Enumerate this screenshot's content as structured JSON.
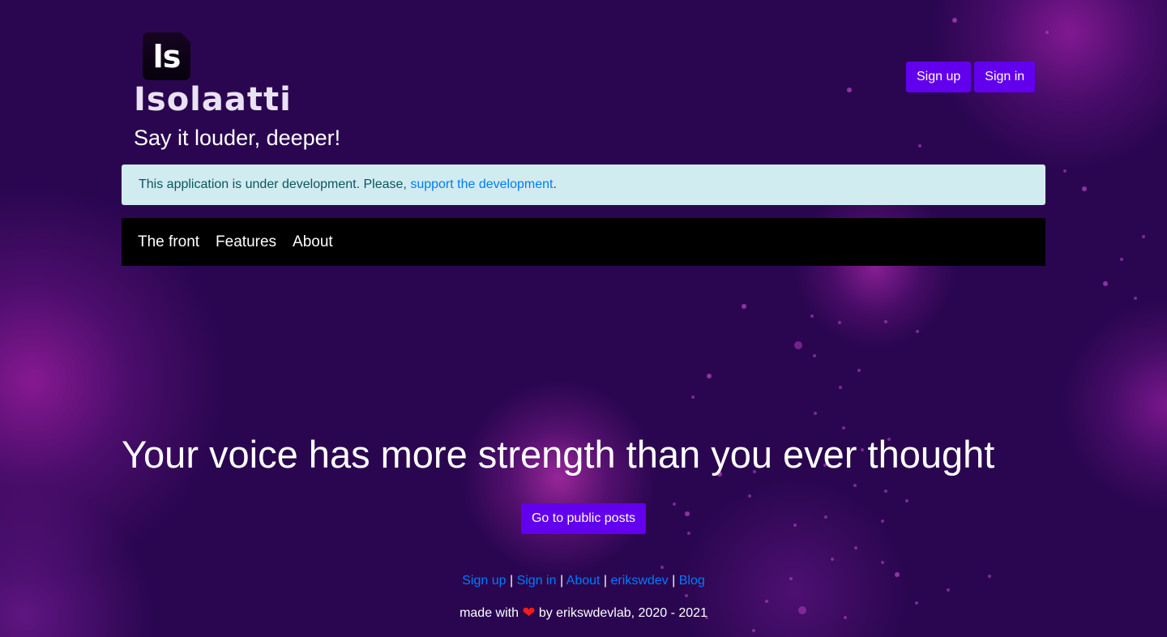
{
  "header": {
    "logo_text": "ls",
    "brand": "Isolaatti",
    "tagline": "Say it louder, deeper!",
    "sign_up": "Sign up",
    "sign_in": "Sign in"
  },
  "alert": {
    "text": "This application is under development. Please, ",
    "link": "support the development",
    "suffix": "."
  },
  "nav": {
    "items": [
      {
        "label": "The front"
      },
      {
        "label": "Features"
      },
      {
        "label": "About"
      }
    ]
  },
  "hero": {
    "headline": "Your voice has more strength than you ever thought",
    "cta": "Go to public posts"
  },
  "footer": {
    "links": [
      {
        "label": "Sign up"
      },
      {
        "label": "Sign in"
      },
      {
        "label": "About"
      },
      {
        "label": "erikswdev"
      },
      {
        "label": "Blog"
      }
    ],
    "separator": "|",
    "made_with": "made with",
    "heart_icon": "heart-icon",
    "credit": "by erikswdevlab, 2020 - 2021"
  },
  "colors": {
    "background": "#2a0650",
    "accent": "#6200ee",
    "link": "#007bff",
    "alert_bg": "#d1ecf1",
    "alert_text": "#0c5460",
    "heart": "#ff1a1a"
  }
}
